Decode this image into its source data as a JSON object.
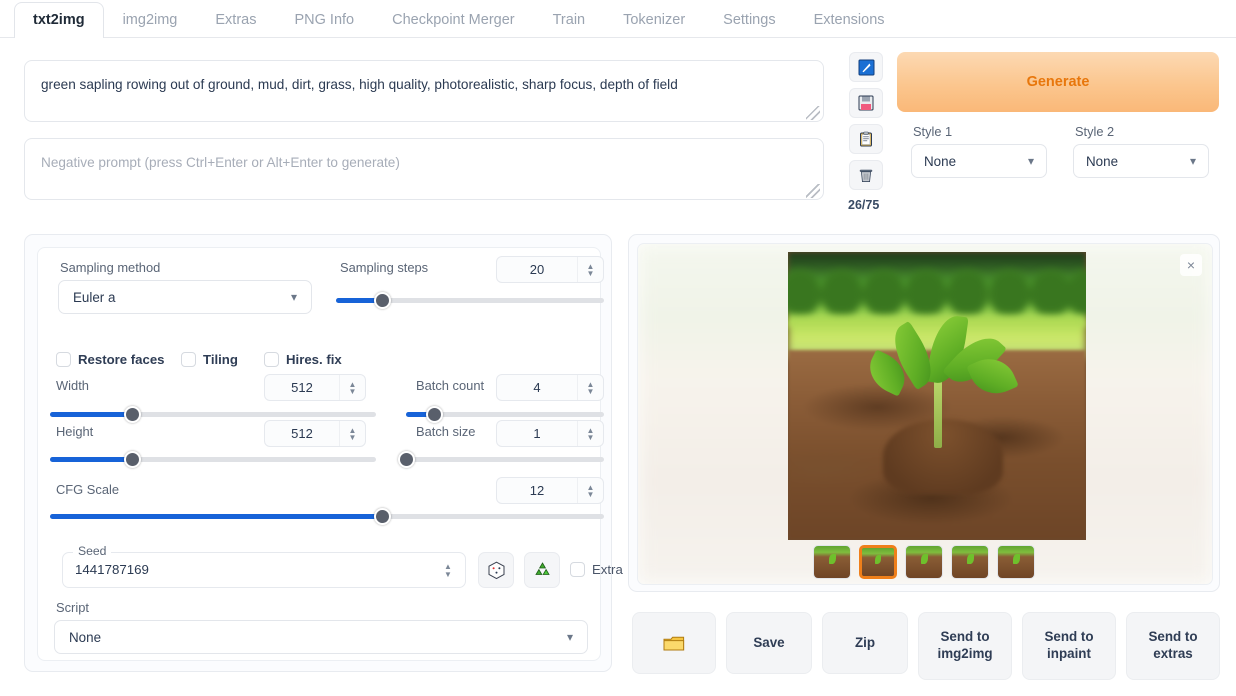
{
  "tabs": [
    {
      "label": "txt2img",
      "active": true
    },
    {
      "label": "img2img",
      "active": false
    },
    {
      "label": "Extras",
      "active": false
    },
    {
      "label": "PNG Info",
      "active": false
    },
    {
      "label": "Checkpoint Merger",
      "active": false
    },
    {
      "label": "Train",
      "active": false
    },
    {
      "label": "Tokenizer",
      "active": false
    },
    {
      "label": "Settings",
      "active": false
    },
    {
      "label": "Extensions",
      "active": false
    }
  ],
  "prompt": {
    "value": "green sapling rowing out of ground, mud, dirt, grass, high quality, photorealistic, sharp focus, depth of field",
    "negative_placeholder": "Negative prompt (press Ctrl+Enter or Alt+Enter to generate)",
    "negative_value": "",
    "token_count": "26/75"
  },
  "icon_buttons": [
    {
      "name": "arrow-box-icon",
      "glyph": "⬛"
    },
    {
      "name": "floppy-save-icon",
      "glyph": "💾"
    },
    {
      "name": "clipboard-icon",
      "glyph": "📋"
    },
    {
      "name": "trash-icon",
      "glyph": "🗑"
    }
  ],
  "generate": {
    "label": "Generate",
    "accent": "#e8770c"
  },
  "styles": {
    "style1_label": "Style 1",
    "style1_value": "None",
    "style2_label": "Style 2",
    "style2_value": "None"
  },
  "settings": {
    "sampling_method_label": "Sampling method",
    "sampling_method_value": "Euler a",
    "sampling_steps_label": "Sampling steps",
    "sampling_steps_value": "20",
    "restore_faces_label": "Restore faces",
    "tiling_label": "Tiling",
    "hires_fix_label": "Hires. fix",
    "width_label": "Width",
    "width_value": "512",
    "height_label": "Height",
    "height_value": "512",
    "batch_count_label": "Batch count",
    "batch_count_value": "4",
    "batch_size_label": "Batch size",
    "batch_size_value": "1",
    "cfg_scale_label": "CFG Scale",
    "cfg_scale_value": "12",
    "seed_label": "Seed",
    "seed_value": "1441787169",
    "dice_icon": "🎲",
    "recycle_icon": "♻",
    "extra_label": "Extra",
    "script_label": "Script",
    "script_value": "None"
  },
  "gallery": {
    "close_icon": "×",
    "thumbnails": [
      {
        "selected": false
      },
      {
        "selected": true
      },
      {
        "selected": false
      },
      {
        "selected": false
      },
      {
        "selected": false
      }
    ],
    "selected_border": "#ef7f1a"
  },
  "actions": {
    "folder_icon": "📂",
    "save": "Save",
    "zip": "Zip",
    "send_img2img": "Send to img2img",
    "send_inpaint": "Send to inpaint",
    "send_extras": "Send to extras"
  }
}
